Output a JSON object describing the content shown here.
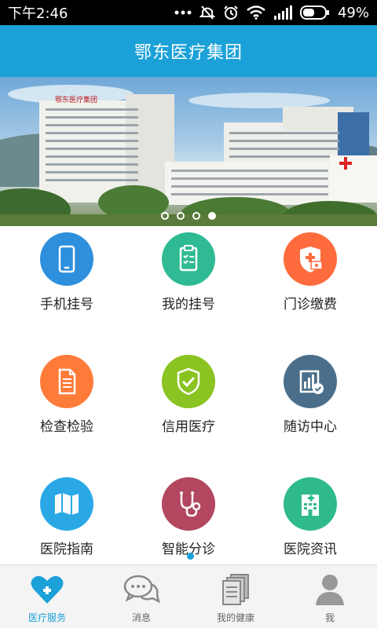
{
  "status_bar": {
    "time": "下午2:46",
    "battery": "49%"
  },
  "header": {
    "title": "鄂东医疗集团"
  },
  "banner": {
    "dots": 4,
    "active_dot": 3
  },
  "services": [
    {
      "label": "手机挂号",
      "icon": "mobile-phone-icon",
      "color": "#2e8fdc"
    },
    {
      "label": "我的挂号",
      "icon": "clipboard-list-icon",
      "color": "#2fba94"
    },
    {
      "label": "门诊缴费",
      "icon": "medical-payment-icon",
      "color": "#ff6b3c"
    },
    {
      "label": "检查检验",
      "icon": "document-icon",
      "color": "#ff7b3a"
    },
    {
      "label": "信用医疗",
      "icon": "shield-check-icon",
      "color": "#8ac322"
    },
    {
      "label": "随访中心",
      "icon": "chart-check-icon",
      "color": "#4b6f8a"
    },
    {
      "label": "医院指南",
      "icon": "map-icon",
      "color": "#2aa8e6"
    },
    {
      "label": "智能分诊",
      "icon": "stethoscope-icon",
      "color": "#b2475f"
    },
    {
      "label": "医院资讯",
      "icon": "hospital-building-icon",
      "color": "#2fba8d"
    }
  ],
  "bottom_nav": [
    {
      "label": "医疗服务",
      "icon": "heart-plus-icon",
      "active": true
    },
    {
      "label": "消息",
      "icon": "chat-bubbles-icon",
      "active": false
    },
    {
      "label": "我的健康",
      "icon": "documents-icon",
      "active": false
    },
    {
      "label": "我",
      "icon": "person-icon",
      "active": false
    }
  ],
  "colors": {
    "accent": "#1ba1d7"
  }
}
